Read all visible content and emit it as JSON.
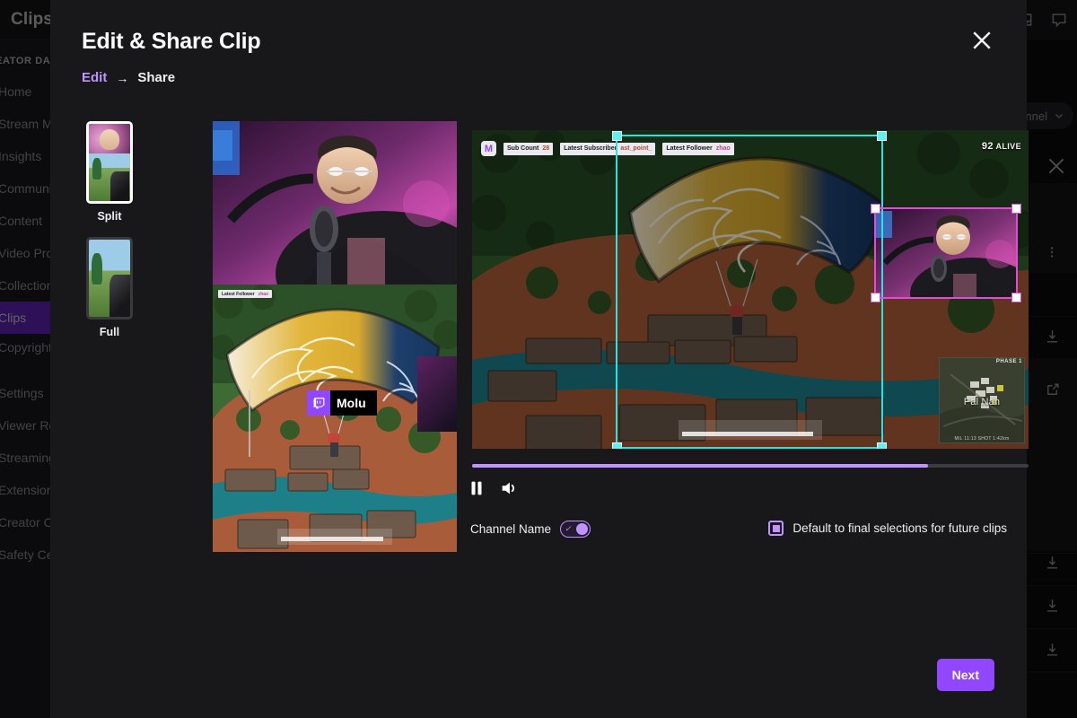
{
  "background": {
    "topbar": {
      "title": "Clips"
    },
    "topbar_icons": [
      {
        "name": "inbox-icon"
      },
      {
        "name": "chat-icon"
      }
    ],
    "sidebar": {
      "header": "CREATOR DASHBOARD",
      "items": [
        {
          "label": "Home",
          "active": false
        },
        {
          "label": "Stream Manager",
          "active": false
        },
        {
          "label": "Insights",
          "active": false
        },
        {
          "label": "Community",
          "active": false
        },
        {
          "label": "Content",
          "active": false
        },
        {
          "label": "Video Producer",
          "active": false
        },
        {
          "label": "Collections",
          "active": false
        },
        {
          "label": "Clips",
          "active": true
        },
        {
          "label": "Copyright Manager",
          "active": false
        },
        {
          "label": "Settings",
          "active": false
        },
        {
          "label": "Viewer Rewards",
          "active": false
        },
        {
          "label": "Streaming Tools",
          "active": false
        },
        {
          "label": "Extensions",
          "active": false
        },
        {
          "label": "Creator Camp",
          "active": false
        },
        {
          "label": "Safety Center",
          "active": false
        }
      ]
    },
    "channel_pill": {
      "label": "Channel",
      "chevron": "chevron-down-icon"
    },
    "close_label": "×",
    "rail_icons": [
      {
        "name": "more-vertical-icon"
      },
      {
        "name": "download-icon"
      },
      {
        "name": "external-link-icon"
      },
      {
        "name": "download-icon"
      },
      {
        "name": "download-icon"
      },
      {
        "name": "download-icon"
      }
    ]
  },
  "modal": {
    "title": "Edit & Share Clip",
    "close_label": "✕",
    "breadcrumb": {
      "current": "Edit",
      "arrow": "→",
      "next": "Share"
    },
    "layouts": [
      {
        "label": "Split",
        "selected": true
      },
      {
        "label": "Full",
        "selected": false
      }
    ],
    "preview": {
      "channel_badge": "twitch-icon",
      "channel_name": "Molu",
      "overlay_chip": {
        "label": "Latest Follower",
        "value": "zhao"
      }
    },
    "source": {
      "overlay_logo": "M",
      "chips": [
        {
          "label": "Sub Count",
          "value": "28"
        },
        {
          "label": "Latest Subscriber",
          "value": "ast_point_"
        },
        {
          "label": "Latest Follower",
          "value": "zhao"
        }
      ],
      "alive_count": "92",
      "alive_label": "ALIVE",
      "minimap": {
        "phase": "PHASE 1",
        "location": "Pal Nan",
        "footer": "MIL 11:13  SHOT  1:42km"
      }
    },
    "transport": {
      "progress_percent": 82,
      "pause_label": "pause-button",
      "volume_label": "volume-button"
    },
    "controls": {
      "channel_name_label": "Channel Name",
      "channel_name_toggle_on": true,
      "default_checkbox_label": "Default to final selections for future clips",
      "default_checkbox_checked": true
    },
    "next_label": "Next"
  },
  "colors": {
    "accent_purple": "#9147ff",
    "light_purple": "#bf94ff",
    "modal_bg": "#18181b",
    "page_bg": "#0e0e10",
    "crop_game": "#2fe0e0",
    "crop_cam": "#e24bd6"
  }
}
